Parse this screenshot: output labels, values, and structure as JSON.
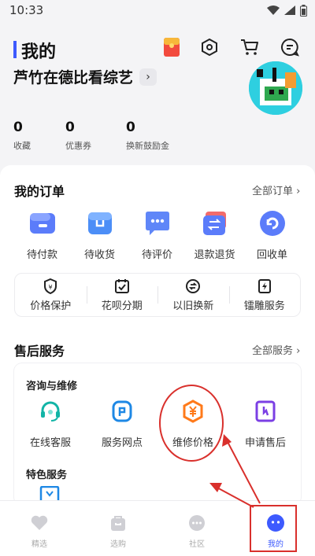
{
  "status": {
    "time": "10:33"
  },
  "header": {
    "title": "我的"
  },
  "user": {
    "name": "芦竹在德比看综艺"
  },
  "stats": [
    {
      "num": "0",
      "label": "收藏"
    },
    {
      "num": "0",
      "label": "优惠券"
    },
    {
      "num": "0",
      "label": "换新鼓励金"
    }
  ],
  "orders": {
    "title": "我的订单",
    "more": "全部订单 ›",
    "items": [
      {
        "label": "待付款",
        "icon": "wallet-icon"
      },
      {
        "label": "待收货",
        "icon": "package-icon"
      },
      {
        "label": "待评价",
        "icon": "comment-icon"
      },
      {
        "label": "退款退货",
        "icon": "refund-icon"
      },
      {
        "label": "回收单",
        "icon": "recycle-icon"
      }
    ]
  },
  "protect": {
    "items": [
      {
        "label": "价格保护",
        "icon": "shield-icon"
      },
      {
        "label": "花呗分期",
        "icon": "calendar-icon"
      },
      {
        "label": "以旧换新",
        "icon": "swap-icon"
      },
      {
        "label": "镭雕服务",
        "icon": "bolt-icon"
      }
    ]
  },
  "after_sales": {
    "title": "售后服务",
    "more": "全部服务 ›",
    "consult_title": "咨询与维修",
    "items": [
      {
        "label": "在线客服",
        "icon": "headset-icon"
      },
      {
        "label": "服务网点",
        "icon": "location-icon"
      },
      {
        "label": "维修价格",
        "icon": "yen-icon"
      },
      {
        "label": "申请售后",
        "icon": "tool-icon"
      }
    ],
    "special_title": "特色服务"
  },
  "tabbar": {
    "items": [
      {
        "label": "精选",
        "icon": "heart-icon"
      },
      {
        "label": "选购",
        "icon": "bag-icon"
      },
      {
        "label": "社区",
        "icon": "chat-icon"
      },
      {
        "label": "我的",
        "icon": "profile-icon"
      }
    ]
  },
  "colors": {
    "accent": "#3d5afe",
    "annotation_red": "#d9302c",
    "service_orange": "#ff7a1a",
    "service_teal": "#12b4a6",
    "service_purple": "#7b3fe4"
  }
}
